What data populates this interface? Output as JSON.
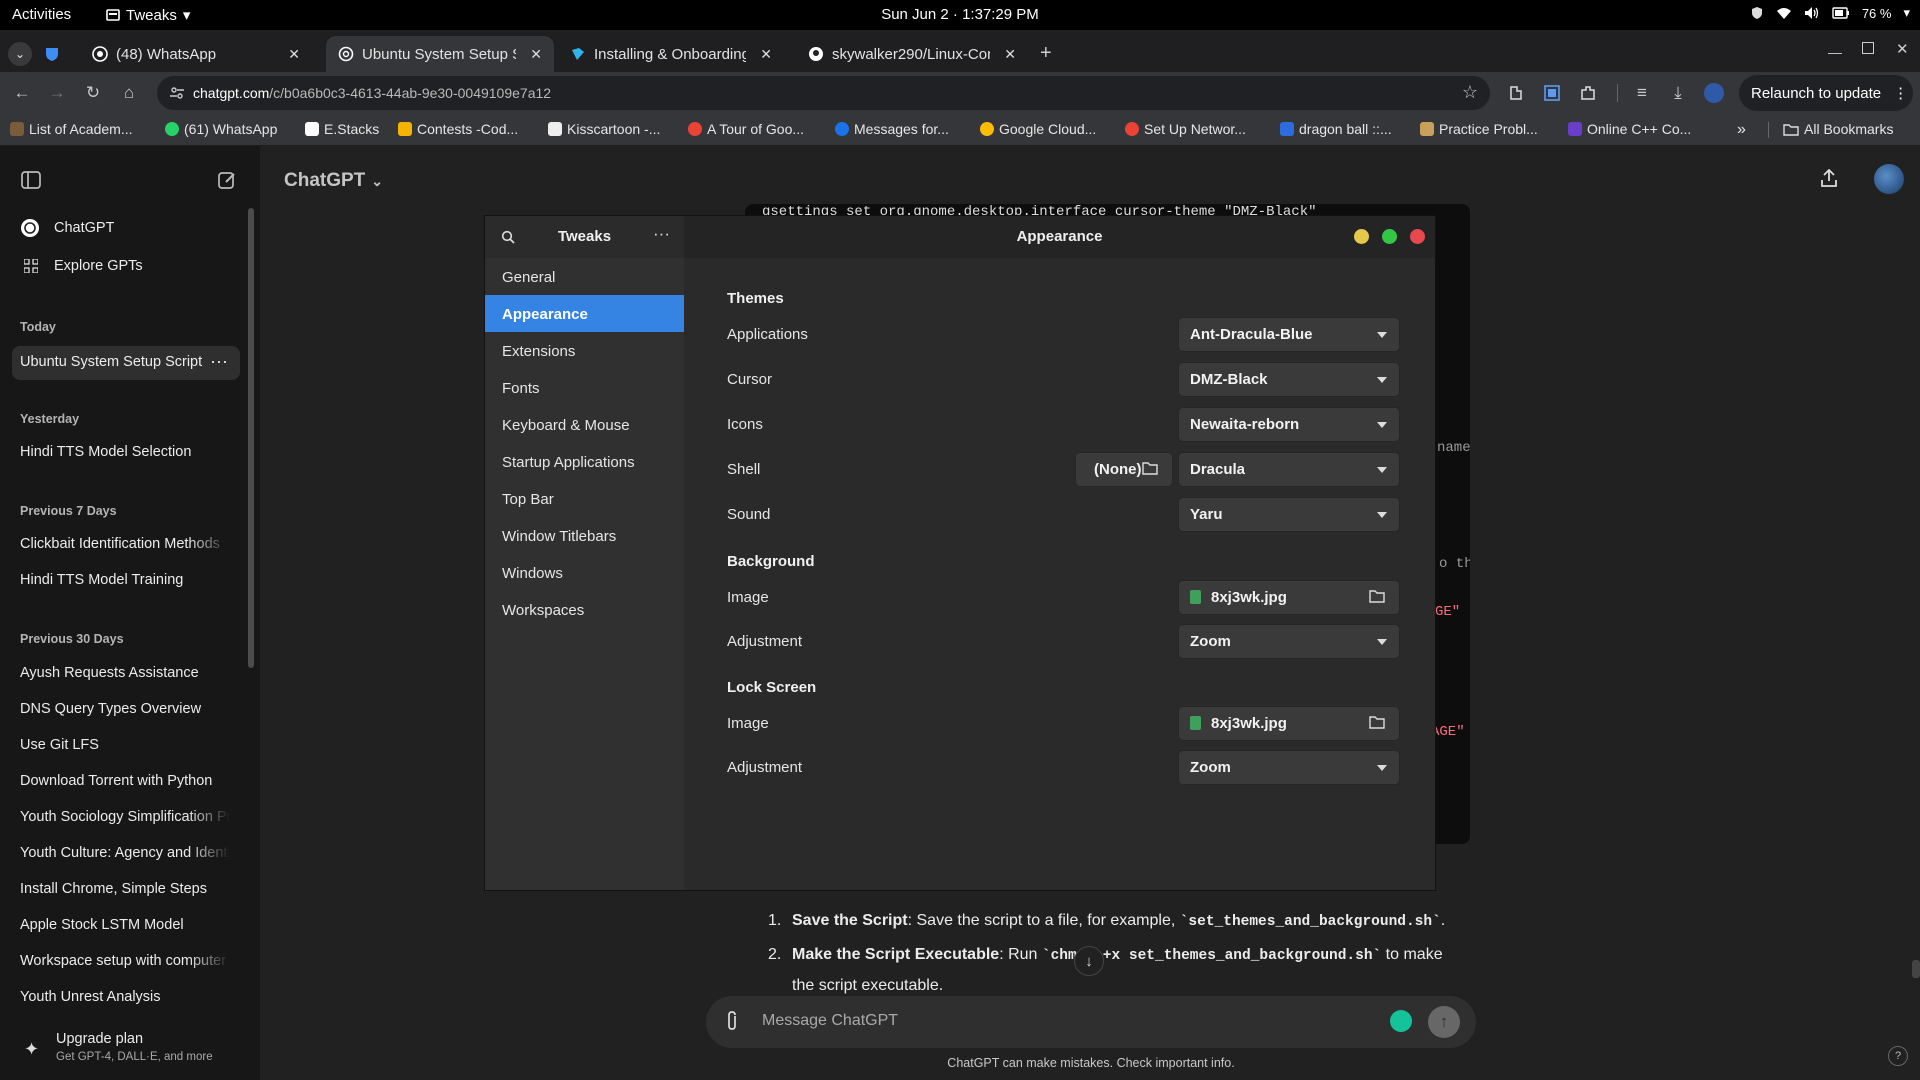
{
  "topbar": {
    "activities": "Activities",
    "app_menu": "Tweaks",
    "clock": "Sun Jun 2 · 1:37:29 PM",
    "battery": "76 %"
  },
  "tabs": [
    {
      "title": "(48) WhatsApp",
      "active": false
    },
    {
      "title": "Ubuntu System Setup Sc",
      "active": true
    },
    {
      "title": "Installing & Onboarding",
      "active": false
    },
    {
      "title": "skywalker290/Linux-Con",
      "active": false
    }
  ],
  "toolbar": {
    "url_domain": "chatgpt.com",
    "url_path": "/c/b0a6b0c3-4613-44ab-9e30-0049109e7a12",
    "relaunch": "Relaunch to update"
  },
  "bookmarks": [
    "List of Academ...",
    "(61) WhatsApp",
    "E.Stacks",
    "Contests -Cod...",
    "Kisscartoon -...",
    "A Tour of Goo...",
    "Messages for...",
    "Google Cloud...",
    "Set Up Networ...",
    "dragon ball ::...",
    "Practice Probl...",
    "Online C++ Co..."
  ],
  "all_bookmarks": "All Bookmarks",
  "sidebar": {
    "chatgpt": "ChatGPT",
    "explore": "Explore GPTs",
    "today": "Today",
    "today_items": [
      "Ubuntu System Setup Script"
    ],
    "yesterday": "Yesterday",
    "yesterday_items": [
      "Hindi TTS Model Selection"
    ],
    "prev7": "Previous 7 Days",
    "prev7_items": [
      "Clickbait Identification Methods",
      "Hindi TTS Model Training"
    ],
    "prev30": "Previous 30 Days",
    "prev30_items": [
      "Ayush Requests Assistance",
      "DNS Query Types Overview",
      "Use Git LFS",
      "Download Torrent with Python",
      "Youth Sociology Simplification Pr",
      "Youth Culture: Agency and Identi",
      "Install Chrome, Simple Steps",
      "Apple Stock LSTM Model",
      "Workspace setup with computer",
      "Youth Unrest Analysis"
    ],
    "upgrade_title": "Upgrade plan",
    "upgrade_sub": "Get GPT-4, DALL·E, and more"
  },
  "main": {
    "model": "ChatGPT",
    "code_top": "gsettings set org.gnome.desktop.interface cursor-theme \"DMZ-Black\"",
    "code_frags": [
      "name)",
      "o the",
      "GE\"",
      "AGE\""
    ],
    "steps": [
      {
        "n": "1.",
        "bold": "Save the Script",
        "text": ": Save the script to a file, for example, ",
        "code": "`set_themes_and_background.sh`",
        "tail": "."
      },
      {
        "n": "2.",
        "bold": "Make the Script Executable",
        "text": ": Run ",
        "code": "`chmod +x set_themes_and_background.sh`",
        "tail": " to make the script executable."
      }
    ],
    "composer_placeholder": "Message ChatGPT",
    "disclaimer": "ChatGPT can make mistakes. Check important info.",
    "help": "?"
  },
  "tweaks": {
    "title": "Tweaks",
    "page_title": "Appearance",
    "nav": [
      "General",
      "Appearance",
      "Extensions",
      "Fonts",
      "Keyboard & Mouse",
      "Startup Applications",
      "Top Bar",
      "Window Titlebars",
      "Windows",
      "Workspaces"
    ],
    "selected_nav": "Appearance",
    "sections": {
      "themes": "Themes",
      "background": "Background",
      "lock_screen": "Lock Screen"
    },
    "labels": {
      "applications": "Applications",
      "cursor": "Cursor",
      "icons": "Icons",
      "shell": "Shell",
      "sound": "Sound",
      "image": "Image",
      "adjustment": "Adjustment"
    },
    "values": {
      "applications": "Ant-Dracula-Blue",
      "cursor": "DMZ-Black",
      "icons": "Newaita-reborn",
      "shell_file": "(None)",
      "shell": "Dracula",
      "sound": "Yaru",
      "bg_image": "8xj3wk.jpg",
      "bg_adjustment": "Zoom",
      "lock_image": "8xj3wk.jpg",
      "lock_adjustment": "Zoom"
    }
  },
  "colors": {
    "accent": "#3584e4",
    "close_dot": "#e5484d",
    "max_dot": "#33c748",
    "min_dot": "#e3c84a"
  }
}
